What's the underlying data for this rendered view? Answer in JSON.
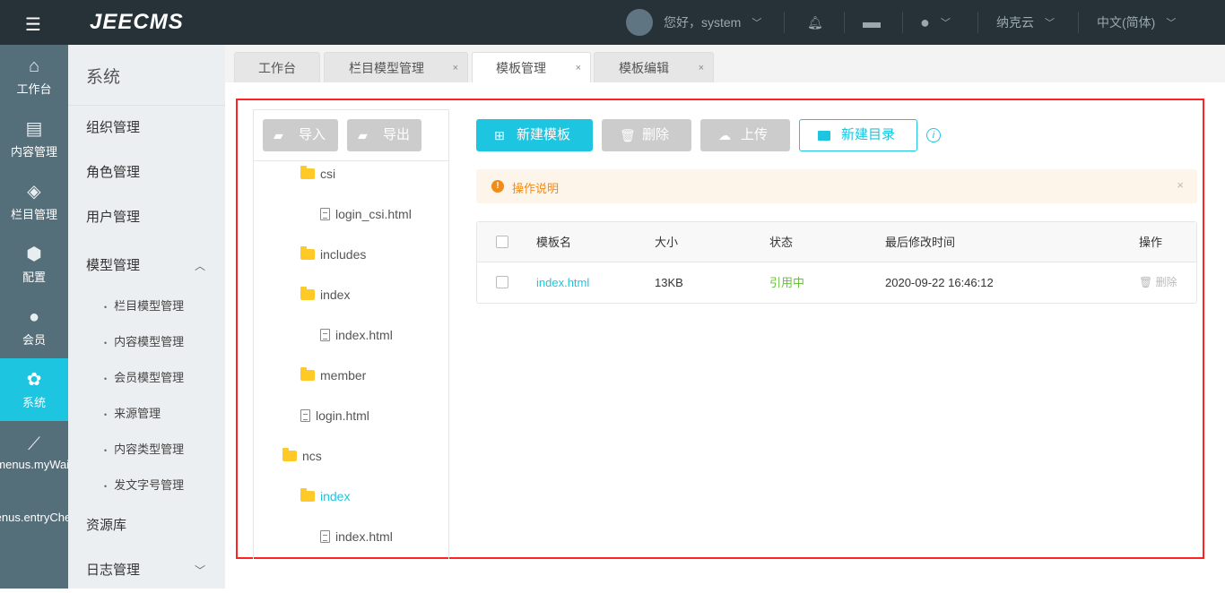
{
  "header": {
    "logo": "JEECMS",
    "greeting": "您好，system",
    "site": "纳克云",
    "language": "中文(简体)"
  },
  "rail": [
    {
      "icon": "home-icon",
      "label": "工作台"
    },
    {
      "icon": "document-icon",
      "label": "内容管理"
    },
    {
      "icon": "layers-icon",
      "label": "栏目管理"
    },
    {
      "icon": "cube-icon",
      "label": "配置"
    },
    {
      "icon": "member-icon",
      "label": "会员"
    },
    {
      "icon": "gear-icon",
      "label": "系统"
    },
    {
      "icon": "chart-icon",
      "label": "menus.myWait"
    },
    {
      "icon": "",
      "label": "menus.entryCheck"
    }
  ],
  "submenu": {
    "title": "系统",
    "items": [
      "组织管理",
      "角色管理",
      "用户管理"
    ],
    "model": {
      "label": "模型管理",
      "children": [
        "栏目模型管理",
        "内容模型管理",
        "会员模型管理",
        "来源管理",
        "内容类型管理",
        "发文字号管理"
      ]
    },
    "after": [
      "资源库",
      "日志管理"
    ]
  },
  "tabs": [
    {
      "label": "工作台"
    },
    {
      "label": "栏目模型管理"
    },
    {
      "label": "模板管理"
    },
    {
      "label": "模板编辑"
    }
  ],
  "tree": {
    "import": "导入",
    "export": "导出",
    "nodes": [
      {
        "type": "folder",
        "label": "csi"
      },
      {
        "type": "file",
        "label": "login_csi.html"
      },
      {
        "type": "folder",
        "label": "includes"
      },
      {
        "type": "folder",
        "label": "index"
      },
      {
        "type": "file",
        "label": "index.html"
      },
      {
        "type": "folder",
        "label": "member"
      },
      {
        "type": "file",
        "label": "login.html"
      },
      {
        "type": "folder",
        "label": "ncs"
      },
      {
        "type": "folder",
        "label": "index"
      },
      {
        "type": "file",
        "label": "index.html"
      }
    ]
  },
  "toolbar": {
    "new_template": "新建模板",
    "delete": "删除",
    "upload": "上传",
    "new_dir": "新建目录"
  },
  "alert": {
    "text": "操作说明"
  },
  "table": {
    "headers": [
      "模板名",
      "大小",
      "状态",
      "最后修改时间",
      "操作"
    ],
    "rows": [
      {
        "name": "index.html",
        "size": "13KB",
        "status": "引用中",
        "modified": "2020-09-22 16:46:12",
        "action": "删除"
      }
    ]
  },
  "colors": {
    "accent": "#1ec5e0",
    "header": "#263238",
    "rail": "#546e7a",
    "status_ok": "#67c23a",
    "warn": "#f08c1a"
  }
}
